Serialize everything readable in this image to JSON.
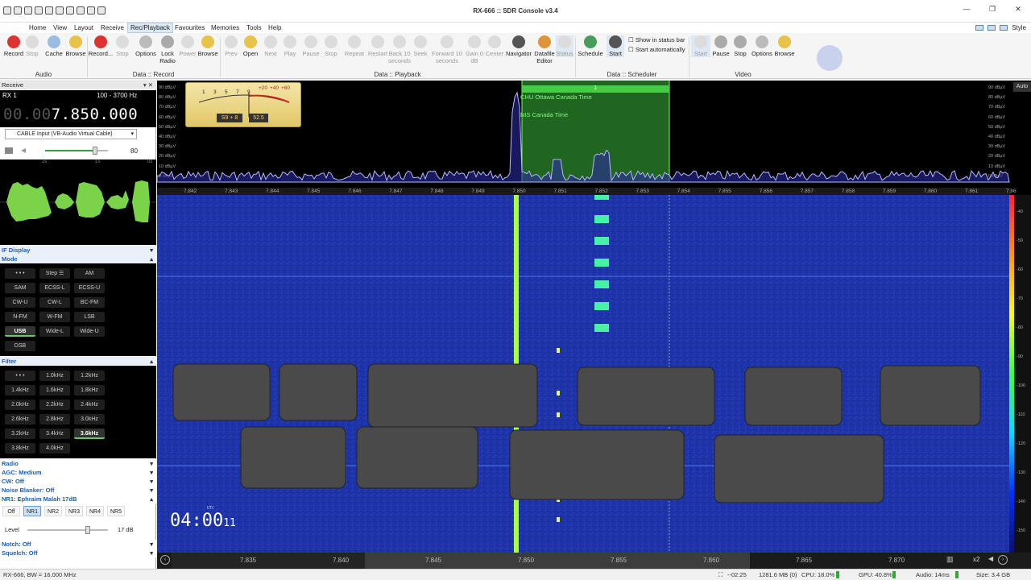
{
  "app": {
    "title": "RX-666 :: SDR Console v3.4"
  },
  "menu": {
    "items": [
      "Home",
      "View",
      "Layout",
      "Receive",
      "Rec/Playback",
      "Favourites",
      "Memories",
      "Tools",
      "Help"
    ],
    "style_label": "Style"
  },
  "ribbon": {
    "buttons": [
      {
        "label": "Record",
        "enabled": true
      },
      {
        "label": "Stop",
        "enabled": false
      },
      {
        "label": "Cache",
        "enabled": true
      },
      {
        "label": "Browse",
        "enabled": true
      },
      {
        "label": "Record...",
        "enabled": true
      },
      {
        "label": "Stop",
        "enabled": false
      },
      {
        "label": "Options",
        "enabled": true
      },
      {
        "label": "Lock Radio",
        "enabled": true
      },
      {
        "label": "Power",
        "enabled": false
      },
      {
        "label": "Browse",
        "enabled": true
      },
      {
        "label": "Prev",
        "enabled": false
      },
      {
        "label": "Open",
        "enabled": true
      },
      {
        "label": "Next",
        "enabled": false
      },
      {
        "label": "Play",
        "enabled": false
      },
      {
        "label": "Pause",
        "enabled": false
      },
      {
        "label": "Stop",
        "enabled": false
      },
      {
        "label": "Repeat",
        "enabled": false
      },
      {
        "label": "Restart",
        "enabled": false
      },
      {
        "label": "Back 10 seconds",
        "enabled": false
      },
      {
        "label": "Seek",
        "enabled": false
      },
      {
        "label": "Forward 10 seconds",
        "enabled": false
      },
      {
        "label": "Gain 0 dB",
        "enabled": false
      },
      {
        "label": "Center",
        "enabled": false
      },
      {
        "label": "Navigator",
        "enabled": true
      },
      {
        "label": "Datafile Editor",
        "enabled": true
      },
      {
        "label": "Status",
        "enabled": false
      },
      {
        "label": "Schedule",
        "enabled": true
      },
      {
        "label": "Start",
        "enabled": true
      },
      {
        "label": "Start",
        "enabled": false
      },
      {
        "label": "Pause",
        "enabled": true
      },
      {
        "label": "Stop",
        "enabled": true
      },
      {
        "label": "Options",
        "enabled": true
      },
      {
        "label": "Browse",
        "enabled": true
      }
    ],
    "checkboxes": [
      "Show in status bar",
      "Start automatically"
    ],
    "groups": [
      "Audio",
      "Data :: Record",
      "Data :: Playback",
      "Data :: Scheduler",
      "Video"
    ]
  },
  "receive": {
    "title": "Receive",
    "rx_label": "RX 1",
    "range": "100 - 3700 Hz",
    "freq_dim": "00.00",
    "freq_main": "7.850.000",
    "input_source": "CABLE Input (VB-Audio Virtual Cable)",
    "volume": "80",
    "volume_level": 0.8,
    "scope_ticks": [
      "2s",
      "1s",
      "0s"
    ]
  },
  "if_display": {
    "label": "IF Display"
  },
  "mode": {
    "label": "Mode",
    "buttons": [
      "• • •",
      "Step ☰",
      "AM",
      "SAM",
      "ECSS-L",
      "ECSS-U",
      "CW-U",
      "CW-L",
      "BC-FM",
      "N-FM",
      "W-FM",
      "LSB",
      "USB",
      "Wide-L",
      "Wide-U",
      "DSB"
    ],
    "selected": "USB"
  },
  "filter": {
    "label": "Filter",
    "buttons": [
      "• • •",
      "1.0kHz",
      "1.2kHz",
      "1.4kHz",
      "1.6kHz",
      "1.8kHz",
      "2.0kHz",
      "2.2kHz",
      "2.4kHz",
      "2.6kHz",
      "2.8kHz",
      "3.0kHz",
      "3.2kHz",
      "3.4kHz",
      "3.6kHz",
      "3.8kHz",
      "4.0kHz"
    ],
    "selected": "3.6kHz"
  },
  "settings": [
    {
      "label": "Radio"
    },
    {
      "label": "AGC: Medium"
    },
    {
      "label": "CW: Off"
    },
    {
      "label": "Noise Blanker: Off"
    },
    {
      "label": "NR1: Ephraim Malah 17dB"
    }
  ],
  "nr": {
    "buttons": [
      "Off",
      "NR1",
      "NR2",
      "NR3",
      "NR4",
      "NR5"
    ],
    "selected": "NR1",
    "level_label": "Level",
    "level_value": "17 dB",
    "level_fraction": 0.75
  },
  "bottom_settings": [
    "Notch: Off",
    "Squelch: Off"
  ],
  "spectrum": {
    "db_ticks": [
      "90 dBµV",
      "80 dBµV",
      "70 dBµV",
      "60 dBµV",
      "50 dBµV",
      "40 dBµV",
      "30 dBµV",
      "20 dBµV",
      "10 dBµV",
      "0 dBµV"
    ],
    "freq_ticks": [
      "7.842",
      "7.843",
      "7.844",
      "7.845",
      "7.846",
      "7.847",
      "7.848",
      "7.849",
      "7.850",
      "7.851",
      "7.852",
      "7.853",
      "7.854",
      "7.855",
      "7.856",
      "7.857",
      "7.858",
      "7.859",
      "7.860",
      "7.861",
      "7.86"
    ],
    "labels": [
      "CHU Ottawa Canada Time",
      "NIS Canada Time"
    ],
    "marker": "1",
    "auto_label": "Auto",
    "smeter_s": "S9 + 8",
    "smeter_db": "52.5",
    "smeter_scale": [
      "1",
      "3",
      "5",
      "7",
      "9",
      "+20",
      "+40",
      "+60"
    ]
  },
  "waterfall": {
    "time_label": "UTC",
    "time_main": "04:00",
    "time_sec": "11",
    "palette_ticks": [
      "-40",
      "-50",
      "-60",
      "-70",
      "-80",
      "-90",
      "-100",
      "-110",
      "-120",
      "-130",
      "-140",
      "-150"
    ]
  },
  "bottom_axis": {
    "ticks": [
      "7.835",
      "7.840",
      "7.845",
      "7.850",
      "7.855",
      "7.860",
      "7.865",
      "7.870"
    ],
    "zoom": "x2"
  },
  "status": {
    "left": "RX-666, BW = 16.000 MHz",
    "clock": "--02:25",
    "memory": "1281.6 MB (0)",
    "cpu": "CPU: 18.0%",
    "gpu": "GPU: 40.8%",
    "audio": "Audio: 14ms",
    "size": "Size: 3.4 GB"
  },
  "colors": {
    "accent": "#1a5fb4",
    "signal": "#76ff4a",
    "waterfall": "#1a2a9a"
  }
}
